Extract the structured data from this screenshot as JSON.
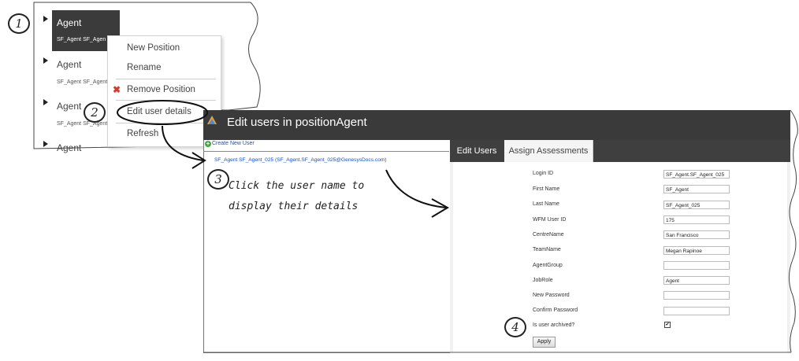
{
  "steps": [
    "1",
    "2",
    "3",
    "4"
  ],
  "tree": {
    "items": [
      {
        "label": "Agent",
        "sub": "SF_Agent SF_Agen"
      },
      {
        "label": "Agent",
        "sub": "SF_Agent SF_Agent"
      },
      {
        "label": "Agent",
        "sub": "SF_Agent SF_Agent"
      },
      {
        "label": "Agent"
      }
    ]
  },
  "context_menu": {
    "items": [
      "New Position",
      "Rename",
      "Remove Position",
      "Edit user details",
      "Refresh"
    ]
  },
  "dialog": {
    "title": "Edit users in positionAgent",
    "create_link": "Create New User",
    "user_entry": "SF_Agent SF_Agent_025 (SF_Agent.SF_Agent_025@GenesysDocs.com)",
    "tabs": [
      "Edit Users",
      "Assign Assessments"
    ],
    "form": {
      "labels": [
        "Login ID",
        "First Name",
        "Last Name",
        "WFM User ID",
        "CentreName",
        "TeamName",
        "AgentGroup",
        "JobRole",
        "New Password",
        "Confirm Password",
        "Is user archived?"
      ],
      "values": [
        "SF_Agent.SF_Agent_025",
        "SF_Agent",
        "SF_Agent_025",
        "175",
        "San Francisco",
        "Megan Rapinoe",
        "",
        "Agent",
        "",
        ""
      ],
      "archived": true,
      "apply_label": "Apply"
    }
  },
  "annotation": {
    "line1": "Click the user name to",
    "line2": "display their details"
  }
}
